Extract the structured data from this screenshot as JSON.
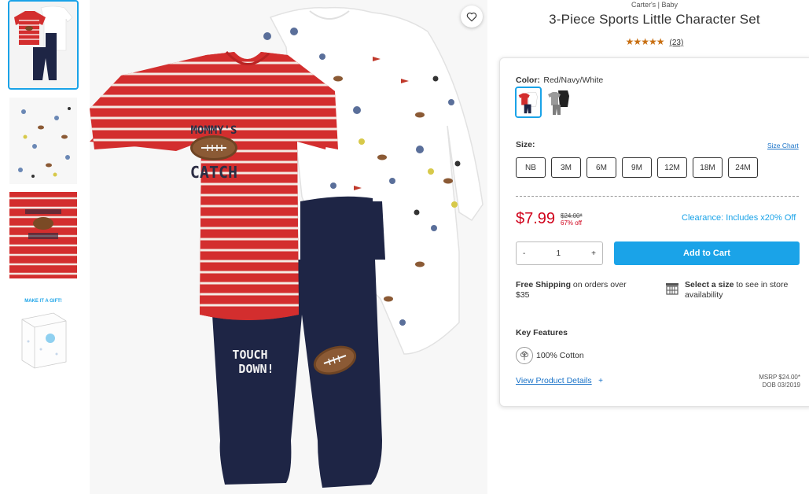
{
  "product": {
    "brand": "Carter's | Baby",
    "title": "3-Piece Sports Little Character Set",
    "stars": "★★★★★",
    "review_count": "(23)"
  },
  "main_image": {
    "shirt_text_1": "MOMMY'S",
    "shirt_text_2": "CATCH",
    "pants_text_1": "TOUCH",
    "pants_text_2": "DOWN!"
  },
  "thumbnails": [
    {
      "kind": "set"
    },
    {
      "kind": "pattern-detail"
    },
    {
      "kind": "shirt-detail"
    },
    {
      "kind": "gift-box",
      "text": "MAKE IT A GIFT!"
    }
  ],
  "color": {
    "label": "Color:",
    "value": "Red/Navy/White",
    "swatches": [
      {
        "name": "Red/Navy/White",
        "selected": true
      },
      {
        "name": "Grey/Black",
        "selected": false
      }
    ]
  },
  "size": {
    "label": "Size:",
    "chart_link": "Size Chart",
    "options": [
      "NB",
      "3M",
      "6M",
      "9M",
      "12M",
      "18M",
      "24M"
    ]
  },
  "pricing": {
    "sale_price": "$7.99",
    "original_price": "$24.00*",
    "percent_off": "67% off",
    "clearance_text": "Clearance: Includes x20% Off"
  },
  "quantity": {
    "minus": "-",
    "value": "1",
    "plus": "+"
  },
  "add_to_cart_label": "Add to Cart",
  "shipping": {
    "bold": "Free Shipping",
    "line1_rest": " on orders over",
    "line2": "$35"
  },
  "store": {
    "bold": "Select a size",
    "line1_rest": " to see in store",
    "line2": "availability"
  },
  "features": {
    "heading": "Key Features",
    "items": [
      "100% Cotton"
    ],
    "details_link": "View Product Details",
    "details_plus": "+",
    "msrp_line1": "MSRP $24.00*",
    "msrp_line2": "DOB 03/2019"
  },
  "colors": {
    "accent": "#1aa3e8",
    "price_red": "#d0021b",
    "star_orange": "#c86f12",
    "shirt_red": "#d32e2e",
    "navy": "#1e2545"
  }
}
